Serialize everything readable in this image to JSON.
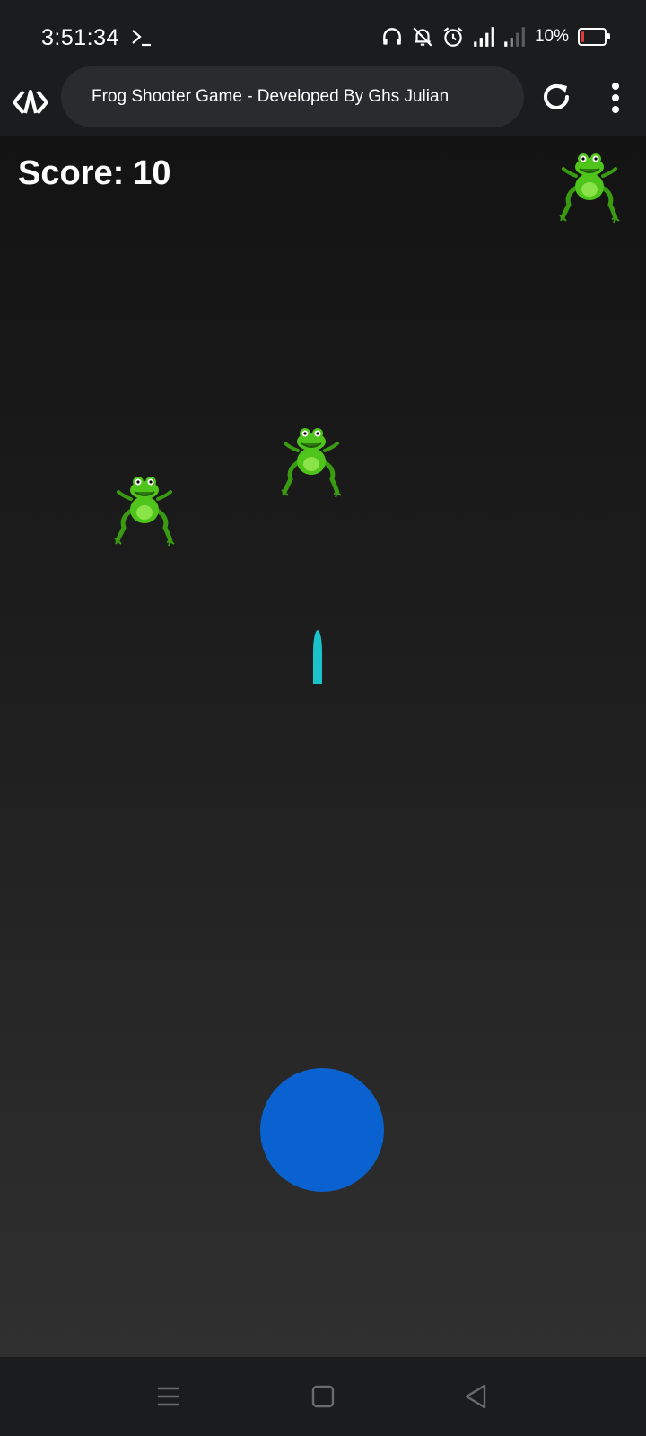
{
  "status_bar": {
    "time": "3:51:34",
    "battery_percent": "10%",
    "battery_level": 0.1,
    "icons": [
      "terminal-icon",
      "headphones-icon",
      "bell-off-icon",
      "alarm-icon",
      "signal-icon",
      "signal-weak-icon",
      "battery-icon"
    ]
  },
  "browser": {
    "page_title": "Frog Shooter Game - Developed By Ghs Julian",
    "icons": [
      "browser-logo-icon",
      "reload-icon",
      "more-vert-icon"
    ]
  },
  "game": {
    "score_label": "Score:",
    "score_value": "10",
    "frog_count": 3,
    "colors": {
      "bullet": "#19c3c9",
      "shooter": "#0a62d0",
      "frog": "#4fc41a"
    }
  },
  "nav_bar": {
    "icons": [
      "recents-icon",
      "home-icon",
      "back-icon"
    ]
  }
}
